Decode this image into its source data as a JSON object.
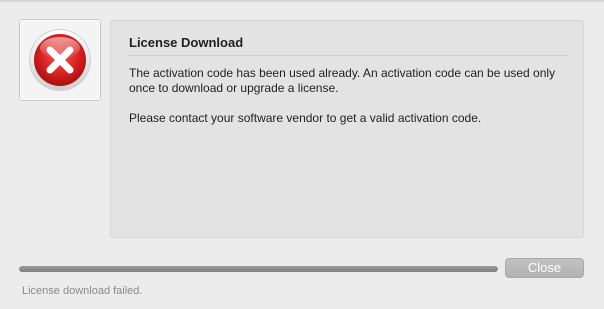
{
  "dialog": {
    "icon": "error-icon",
    "title": "License Download",
    "message_paragraphs": [
      "The activation code has been used already. An activation code can be used only once to download or upgrade a license.",
      "Please contact your software vendor to get a valid activation code."
    ],
    "progress_fraction": 1.0,
    "close_label": "Close",
    "status": "License download failed."
  },
  "colors": {
    "error_red": "#d21f1f",
    "panel_background": "#e3e3e3",
    "window_background": "#ececec"
  }
}
